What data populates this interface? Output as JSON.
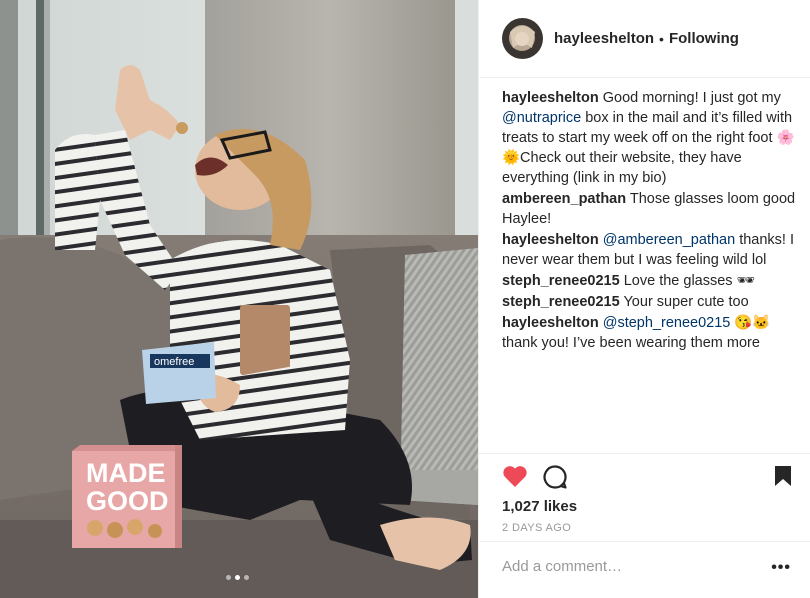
{
  "post": {
    "username": "hayleeshelton",
    "separator": "•",
    "follow_status": "Following"
  },
  "comments": [
    {
      "user": "hayleeshelton",
      "text_before": "Good morning! I just got my ",
      "mention": "@nutraprice",
      "text_after": " box in the mail and it’s filled with treats to start my week off on the right foot 🌸 🌞Check out their website, they have everything (link in my bio)"
    },
    {
      "user": "ambereen_pathan",
      "text_before": "Those glasses loom good Haylee!",
      "mention": "",
      "text_after": ""
    },
    {
      "user": "hayleeshelton",
      "text_before": "",
      "mention": "@ambereen_pathan",
      "text_after": " thanks! I never wear them but I was feeling wild lol"
    },
    {
      "user": "steph_renee0215",
      "text_before": "Love the glasses 🕶",
      "mention": "",
      "text_after": ""
    },
    {
      "user": "steph_renee0215",
      "text_before": "Your super cute too",
      "mention": "",
      "text_after": ""
    },
    {
      "user": "hayleeshelton",
      "text_before": "",
      "mention": "@steph_renee0215",
      "text_after": " 😘🐱 thank you! I’ve been wearing them more"
    }
  ],
  "likes": "1,027 likes",
  "timestamp": "2 DAYS AGO",
  "comment_box": {
    "placeholder": "Add a comment…",
    "more": "•••"
  },
  "product_box": {
    "line1": "MADE",
    "line2": "GOOD"
  },
  "snack_bag": {
    "label": "omefree"
  },
  "carousel": {
    "count": 3,
    "active_index": 1
  },
  "colors": {
    "like_red": "#ed4956",
    "mention_blue": "#003569",
    "muted_gray": "#999999",
    "divider": "#efefef"
  }
}
